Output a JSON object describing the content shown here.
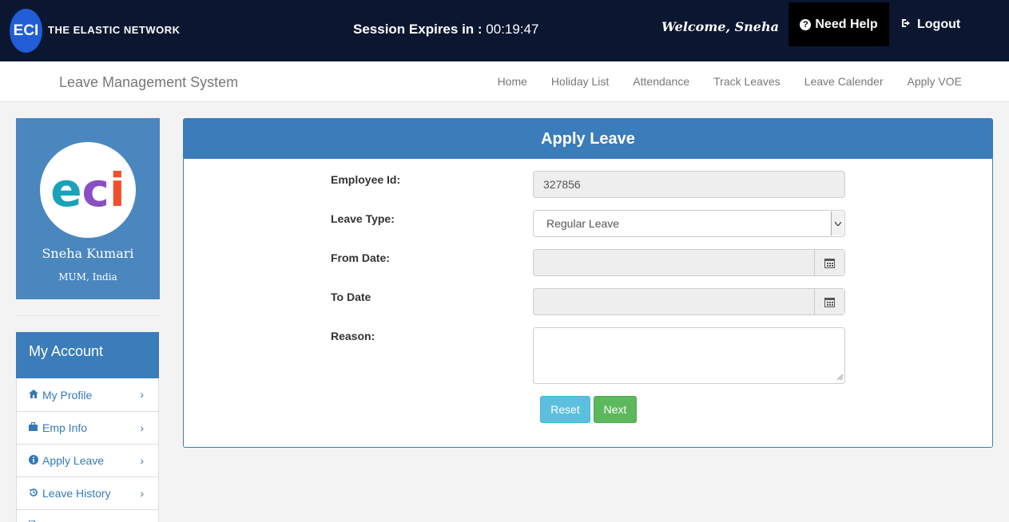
{
  "header": {
    "logo_text": "ECI",
    "company_name": "THE ELASTIC NETWORK",
    "session_label": "Session Expires in :",
    "session_time": "00:19:47",
    "welcome": "Welcome, Sneha",
    "help_label": "Need Help",
    "logout_label": "Logout"
  },
  "navbar": {
    "brand": "Leave Management System",
    "links": [
      "Home",
      "Holiday List",
      "Attendance",
      "Track Leaves",
      "Leave Calender",
      "Apply VOE"
    ]
  },
  "profile": {
    "avatar_text": "eci",
    "name": "Sneha Kumari",
    "location": "MUM, India"
  },
  "account": {
    "title": "My Account",
    "items": [
      {
        "label": "My Profile",
        "icon": "home-icon"
      },
      {
        "label": "Emp Info",
        "icon": "briefcase-icon"
      },
      {
        "label": "Apply Leave",
        "icon": "info-icon"
      },
      {
        "label": "Leave History",
        "icon": "history-icon"
      }
    ]
  },
  "form": {
    "title": "Apply Leave",
    "employee_id_label": "Employee Id:",
    "employee_id_value": "327856",
    "leave_type_label": "Leave Type:",
    "leave_type_value": "Regular Leave",
    "from_date_label": "From Date:",
    "from_date_value": "",
    "to_date_label": "To Date",
    "to_date_value": "",
    "reason_label": "Reason:",
    "reason_value": "",
    "reset_label": "Reset",
    "next_label": "Next"
  },
  "colors": {
    "topbar": "#0b1631",
    "primary": "#3b7cba",
    "reset": "#5bc0de",
    "next": "#5cb85c"
  }
}
